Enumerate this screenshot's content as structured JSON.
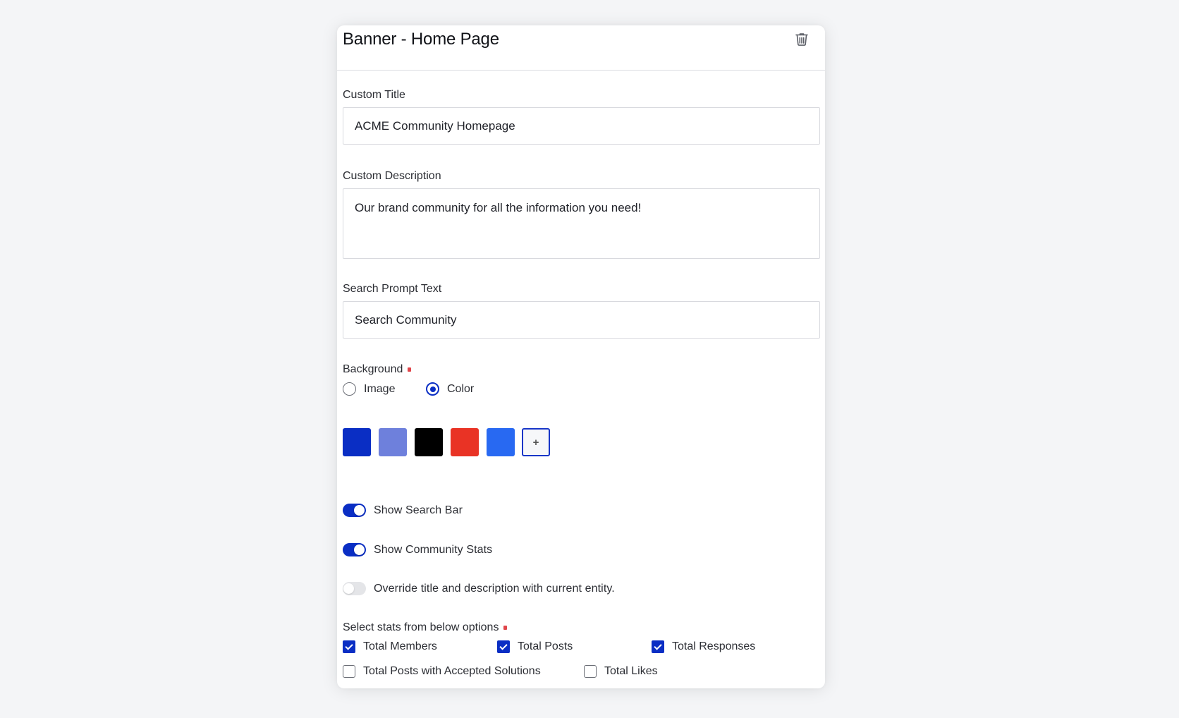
{
  "panel": {
    "title": "Banner - Home Page",
    "delete_icon": "trash-icon"
  },
  "fields": {
    "custom_title": {
      "label": "Custom Title",
      "value": "ACME Community Homepage"
    },
    "custom_description": {
      "label": "Custom Description",
      "value": "Our brand community for all the information you need!"
    },
    "search_prompt": {
      "label": "Search Prompt Text",
      "value": "Search Community"
    }
  },
  "background": {
    "label": "Background",
    "required": true,
    "options": [
      {
        "label": "Image",
        "selected": false
      },
      {
        "label": "Color",
        "selected": true
      }
    ],
    "swatches": [
      "#0a2ec4",
      "#6e80dc",
      "#000000",
      "#e93325",
      "#2869f2"
    ],
    "add_swatch_label": "+"
  },
  "toggles": [
    {
      "label": "Show Search Bar",
      "on": true
    },
    {
      "label": "Show Community Stats",
      "on": true
    },
    {
      "label": "Override title and description with current entity.",
      "on": false
    }
  ],
  "stats": {
    "label": "Select stats from below options",
    "required": true,
    "options": [
      {
        "label": "Total Members",
        "checked": true
      },
      {
        "label": "Total Posts",
        "checked": true
      },
      {
        "label": "Total Responses",
        "checked": true
      },
      {
        "label": "Total Posts with Accepted Solutions",
        "checked": false
      },
      {
        "label": "Total Likes",
        "checked": false
      }
    ]
  },
  "colors": {
    "accent": "#0a2ec4",
    "required_marker": "#e0454a"
  }
}
